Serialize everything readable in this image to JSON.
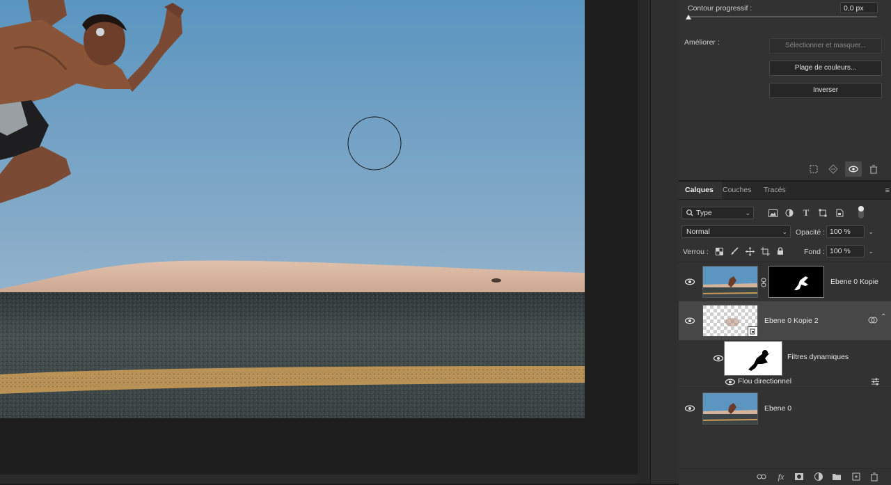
{
  "properties": {
    "feather_label": "Contour progressif :",
    "feather_value": "0,0 px",
    "refine_label": "Améliorer :",
    "select_mask_button": "Sélectionner et masquer...",
    "color_range_button": "Plage de couleurs...",
    "invert_button": "Inverser"
  },
  "layers_panel": {
    "tabs": [
      {
        "label": "Calques",
        "active": true
      },
      {
        "label": "Couches",
        "active": false
      },
      {
        "label": "Tracés",
        "active": false
      }
    ],
    "filter_type": "Type",
    "blend_mode": "Normal",
    "opacity_label": "Opacité :",
    "opacity_value": "100 %",
    "lock_label": "Verrou :",
    "fill_label": "Fond :",
    "fill_value": "100 %",
    "layers": [
      {
        "name": "Ebene 0 Kopie",
        "visible": true,
        "has_mask": true
      },
      {
        "name": "Ebene 0 Kopie 2",
        "visible": true,
        "smart_object": true,
        "selected": true
      },
      {
        "name": "Filtres dynamiques",
        "visible": true
      },
      {
        "name": "Flou directionnel",
        "visible": true
      },
      {
        "name": "Ebene 0",
        "visible": true
      }
    ]
  },
  "colors": {
    "panel_bg": "#323232",
    "canvas_bg": "#1e1e1e",
    "sky_top": "#5f9ac3",
    "sky_bottom": "#a6bfd1",
    "sand": "#d8b7a2",
    "asphalt": "#3d4547",
    "road_line": "#c99a57"
  },
  "icons": {
    "search": "search-icon",
    "visibility": "eye-icon",
    "link": "link-icon",
    "delete": "trash-icon"
  }
}
